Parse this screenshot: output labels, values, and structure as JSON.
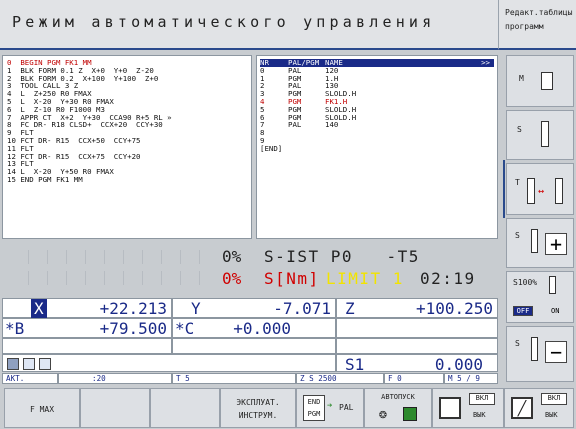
{
  "header": {
    "title": "Режим автоматического управления",
    "right_line1": "Редакт.таблицы",
    "right_line2": "программ"
  },
  "program": [
    "0  BEGIN PGM FK1 MM",
    "1  BLK FORM 0.1 Z  X+0  Y+0  Z-20",
    "2  BLK FORM 0.2  X+100  Y+100  Z+0",
    "3  TOOL CALL 3 Z",
    "4  L  Z+250 R0 FMAX",
    "5  L  X-20  Y+30 R0 FMAX",
    "6  L  Z-10 R0 F1000 M3",
    "7  APPR CT  X+2  Y+30  CCA90 R+5 RL »",
    "8  FC DR- R18 CLSD+  CCX+20  CCY+30",
    "9  FLT",
    "10 FCT DR- R15  CCX+50  CCY+75",
    "11 FLT",
    "12 FCT DR- R15  CCX+75  CCY+20",
    "13 FLT",
    "14 L  X-20  Y+50 R0 FMAX",
    "15 END PGM FK1 MM"
  ],
  "pallet": {
    "headers": [
      "NR",
      "PAL/PGM",
      "NAME",
      ">>"
    ],
    "rows": [
      [
        "0",
        "PAL",
        "120"
      ],
      [
        "1",
        "PGM",
        "1.H"
      ],
      [
        "2",
        "PAL",
        "130"
      ],
      [
        "3",
        "PGM",
        "SLOLD.H"
      ],
      [
        "4",
        "PGM",
        "FK1.H"
      ],
      [
        "5",
        "PGM",
        "SLOLD.H"
      ],
      [
        "6",
        "PGM",
        "SLOLD.H"
      ],
      [
        "7",
        "PAL",
        "140"
      ],
      [
        "8",
        "",
        ""
      ],
      [
        "9",
        "",
        ""
      ],
      [
        "[END]",
        "",
        ""
      ]
    ],
    "selected_index": 4
  },
  "status": {
    "line1_pct": "0%",
    "line1_text": "S-IST P0   -T5",
    "line2_pct": "0%",
    "line2_text": "S[Nm]",
    "limit_text": "LIMIT 1",
    "time": "02:19"
  },
  "positions": {
    "x_label": "X",
    "x_value": "+22.213",
    "y_label": "Y",
    "y_value": "-7.071",
    "z_label": "Z",
    "z_value": "+100.250",
    "b_label": "*B",
    "b_value": "+79.500",
    "c_label": "*C",
    "c_value": "+0.000"
  },
  "spindle": {
    "label": "S1",
    "value": "0.000"
  },
  "status_bar": {
    "mode": "АКТ.",
    "t20": ":20",
    "tool": "T 5",
    "spindle": "Z S 2500",
    "feed": "F 0",
    "m": "M 5 / 9"
  },
  "right_keys": {
    "m": "M",
    "s": "S",
    "t": "T",
    "s_plus": "S",
    "s_override": "S100%",
    "off": "OFF",
    "on": "ON",
    "s_minus": "S"
  },
  "bottom_keys": {
    "fmax": "F MAX",
    "exploit_line1": "ЭКСПЛУАТ.",
    "exploit_line2": "ИНСТРУМ.",
    "end_pgm_top": "END",
    "end_pgm_bottom": "PGM",
    "pal": "PAL",
    "autostart": "АВТОПУСК",
    "on1": "ВКЛ",
    "off1": "ВЫК",
    "on2": "ВКЛ",
    "off2": "ВЫК"
  },
  "colors": {
    "accent": "#1a2a88",
    "alert_red": "#d00000",
    "limit_yellow": "#f2e400"
  }
}
